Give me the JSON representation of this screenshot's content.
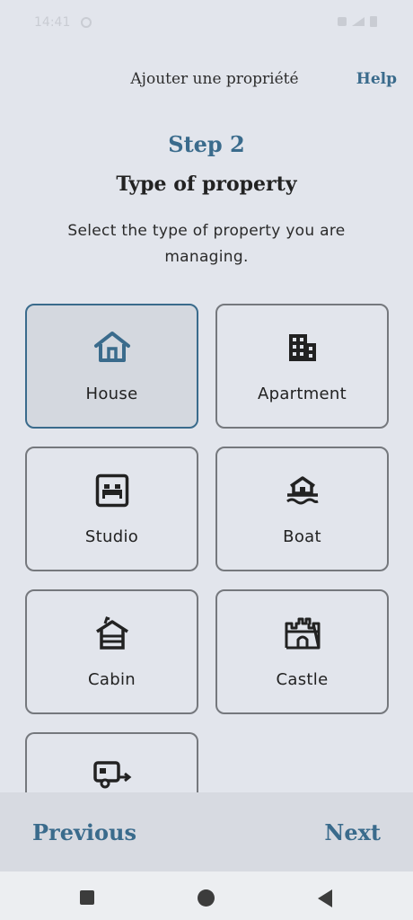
{
  "status_bar": {
    "time": "14:41"
  },
  "header": {
    "title": "Ajouter une propriété",
    "help_label": "Help"
  },
  "step": {
    "label": "Step 2",
    "title": "Type of property",
    "description": "Select the type of property you are managing."
  },
  "property_types": [
    {
      "label": "House",
      "icon": "house-icon",
      "selected": true
    },
    {
      "label": "Apartment",
      "icon": "building-icon",
      "selected": false
    },
    {
      "label": "Studio",
      "icon": "bed-icon",
      "selected": false
    },
    {
      "label": "Boat",
      "icon": "boat-icon",
      "selected": false
    },
    {
      "label": "Cabin",
      "icon": "cabin-icon",
      "selected": false
    },
    {
      "label": "Castle",
      "icon": "castle-icon",
      "selected": false
    },
    {
      "label": "",
      "icon": "caravan-icon",
      "selected": false
    }
  ],
  "footer": {
    "previous_label": "Previous",
    "next_label": "Next"
  },
  "colors": {
    "accent": "#3a6b8c",
    "background": "#e2e5ec",
    "selected_bg": "#d4d8df",
    "border": "#75787d"
  }
}
